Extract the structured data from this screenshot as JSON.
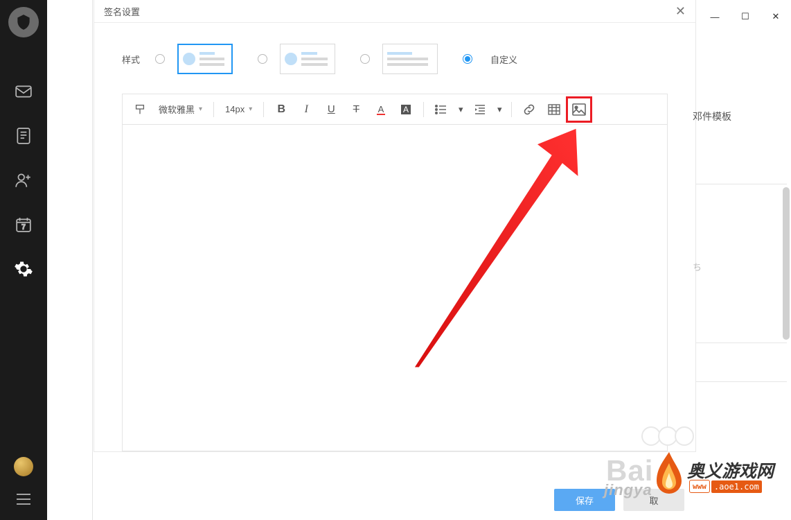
{
  "dialog": {
    "title": "签名设置",
    "style_label": "样式",
    "custom_label": "自定义",
    "save_label": "保存",
    "cancel_label": "取"
  },
  "toolbar": {
    "font_family": "微软雅黑",
    "font_size": "14px"
  },
  "window_controls": {
    "minimize_char": "—",
    "maximize_char": "☐",
    "close_char": "✕"
  },
  "right_panel": {
    "template_label": "邓件模板",
    "text_fragment": "ち"
  },
  "watermark": {
    "brand1": "Bai",
    "brand2": "jingya"
  },
  "logo": {
    "title": "奥义游戏网",
    "url_prefix": "www",
    "url": ".aoe1.com"
  }
}
